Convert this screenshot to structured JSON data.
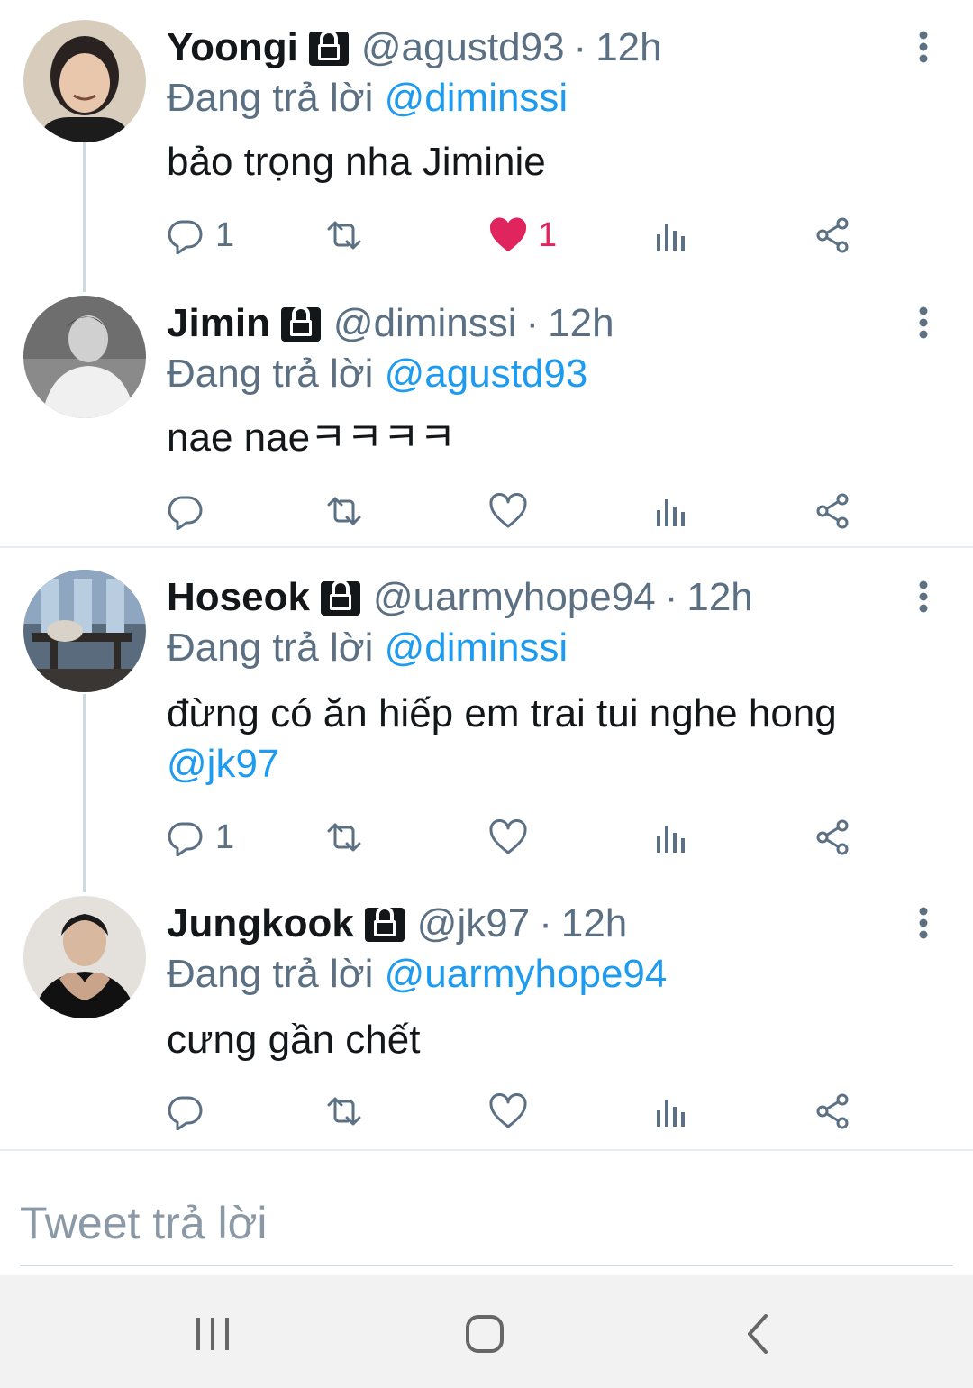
{
  "tweets": [
    {
      "name": "Yoongi",
      "handle": "@agustd93",
      "separator": "·",
      "time": "12h",
      "reply_prefix": "Đang trả lời",
      "reply_to": "@diminssi",
      "text": "bảo trọng nha Jiminie",
      "text_mention": "",
      "reply_count": "1",
      "like_count": "1",
      "liked": true
    },
    {
      "name": "Jimin",
      "handle": "@diminssi",
      "separator": "·",
      "time": "12h",
      "reply_prefix": "Đang trả lời",
      "reply_to": "@agustd93",
      "text": "nae naeㅋㅋㅋㅋ",
      "text_mention": "",
      "reply_count": "",
      "like_count": "",
      "liked": false
    },
    {
      "name": "Hoseok",
      "handle": "@uarmyhope94",
      "separator": "·",
      "time": "12h",
      "reply_prefix": "Đang trả lời",
      "reply_to": "@diminssi",
      "text": "đừng có ăn hiếp em trai tui nghe hong",
      "text_mention": "@jk97",
      "reply_count": "1",
      "like_count": "",
      "liked": false
    },
    {
      "name": "Jungkook",
      "handle": "@jk97",
      "separator": "·",
      "time": "12h",
      "reply_prefix": "Đang trả lời",
      "reply_to": "@uarmyhope94",
      "text": "cưng gần chết",
      "text_mention": "",
      "reply_count": "",
      "like_count": "",
      "liked": false
    }
  ],
  "compose": {
    "placeholder": "Tweet trả lời"
  },
  "colors": {
    "accent": "#1d9bf0",
    "like": "#e0245e",
    "secondary_text": "#5b7083"
  },
  "icons": {
    "reply": "reply-icon",
    "retweet": "retweet-icon",
    "like": "heart-icon",
    "analytics": "analytics-icon",
    "share": "share-icon",
    "lock": "lock-icon",
    "more": "more-vertical-icon"
  }
}
